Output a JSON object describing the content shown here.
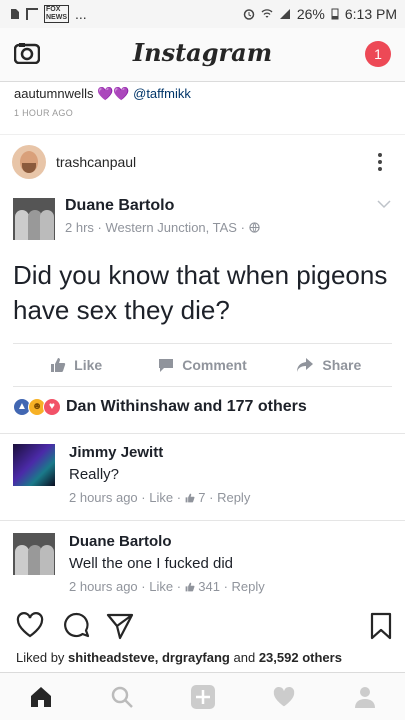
{
  "status": {
    "battery": "26%",
    "time": "6:13 PM",
    "dots": "..."
  },
  "header": {
    "logo": "Instagram",
    "notification_count": "1"
  },
  "caption": {
    "user": "aautumnwells",
    "hearts": "💜💜",
    "mention": "@taffmikk",
    "time": "1 HOUR AGO"
  },
  "post": {
    "username": "trashcanpaul"
  },
  "fb_post": {
    "author": "Duane Bartolo",
    "meta": "2 hrs · Western Junction, TAS ·",
    "text": "Did you know that when pigeons have sex they die?",
    "actions": {
      "like": "Like",
      "comment": "Comment",
      "share": "Share"
    },
    "reactions_text": "Dan Withinshaw and 177 others",
    "comments": [
      {
        "name": "Jimmy Jewitt",
        "text": "Really?",
        "time": "2 hours ago",
        "like": "Like",
        "count": "7",
        "reply": "Reply"
      },
      {
        "name": "Duane Bartolo",
        "text": "Well the one I fucked did",
        "time": "2 hours ago",
        "like": "Like",
        "count": "341",
        "reply": "Reply"
      }
    ]
  },
  "likes": {
    "prefix": "Liked by",
    "users": "shitheadsteve, drgrayfang",
    "and": "and",
    "count": "23,592 others"
  },
  "colors": {
    "notification": "#ed4956",
    "fb_blue": "#4267b2",
    "meta_gray": "#90949c"
  }
}
